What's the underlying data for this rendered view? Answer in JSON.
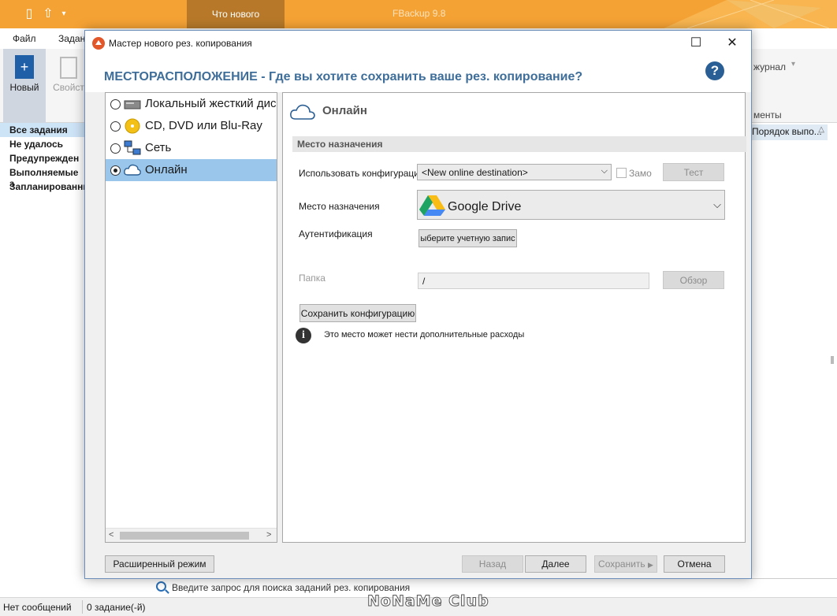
{
  "app": {
    "title": "FBackup 9.8",
    "title_tab": "Что нового",
    "menu_tabs": [
      "Файл",
      "Задан"
    ],
    "ribbon": {
      "new_label": "Новый",
      "props_label": "Свойст",
      "journal_label": "журнал",
      "elements_label": "менты"
    },
    "column_header": "Порядок выпо...",
    "left_items": [
      "Все задания",
      "Не удалось",
      "Предупрежден",
      "Выполняемые з",
      "Запланированны"
    ],
    "search_placeholder": "Введите запрос для поиска заданий рез. копирования",
    "status": {
      "messages": "Нет сообщений",
      "jobs": "0 задание(-й)"
    },
    "watermark": "NoNaMe Club"
  },
  "dialog": {
    "title": "Мастер нового рез. копирования",
    "header": "МЕСТОРАСПОЛОЖЕНИЕ - Где вы хотите сохранить ваше рез. копирование?",
    "nav": [
      {
        "label": "Локальный жесткий дис",
        "icon": "hard-drive-icon",
        "selected": false
      },
      {
        "label": "CD, DVD или Blu-Ray",
        "icon": "disc-icon",
        "selected": false
      },
      {
        "label": "Сеть",
        "icon": "network-icon",
        "selected": false
      },
      {
        "label": "Онлайн",
        "icon": "cloud-icon",
        "selected": true
      }
    ],
    "content": {
      "title": "Онлайн",
      "section": "Место назначения",
      "use_config_label": "Использовать конфигураци",
      "use_config_value": "<New online destination>",
      "remember_label": "Замо",
      "test_button": "Тест",
      "destination_label": "Место назначения",
      "destination_value": "Google Drive",
      "auth_label": "Аутентификация",
      "auth_button": "ыберите учетную запис",
      "folder_label": "Папка",
      "folder_value": "/",
      "browse_button": "Обзор",
      "save_config_button": "Сохранить конфигурацию",
      "info_text": "Это место может нести дополнительные расходы"
    },
    "buttons": {
      "advanced": "Расширенный режим",
      "back": "Назад",
      "next": "Далее",
      "save": "Сохранить",
      "cancel": "Отмена"
    }
  },
  "colors": {
    "accent_orange": "#f5a234",
    "header_blue": "#3e6e99",
    "selection_blue": "#99c6ea"
  }
}
